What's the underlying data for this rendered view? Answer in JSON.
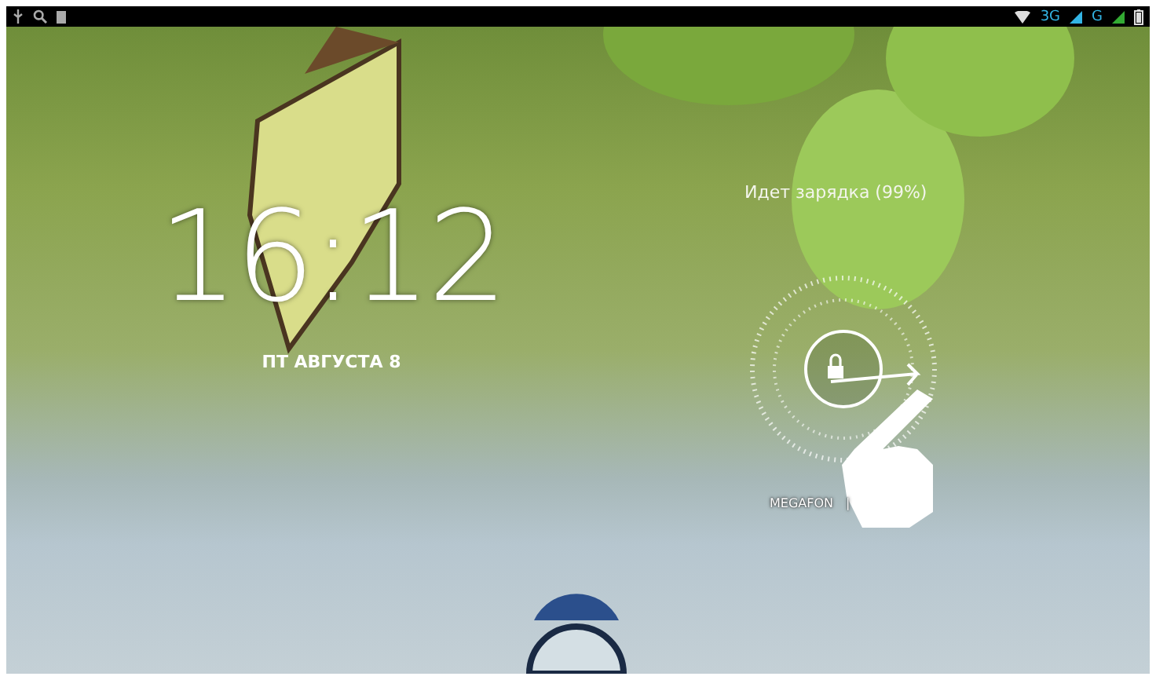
{
  "status_bar": {
    "network_labels": [
      "3G",
      "G"
    ]
  },
  "clock": {
    "time": "16:12",
    "date": "ПТ АВГУСТА 8"
  },
  "charging_status": "Идет зарядка (99%)",
  "carrier": {
    "name": "MEGAFON",
    "separator": "|"
  }
}
